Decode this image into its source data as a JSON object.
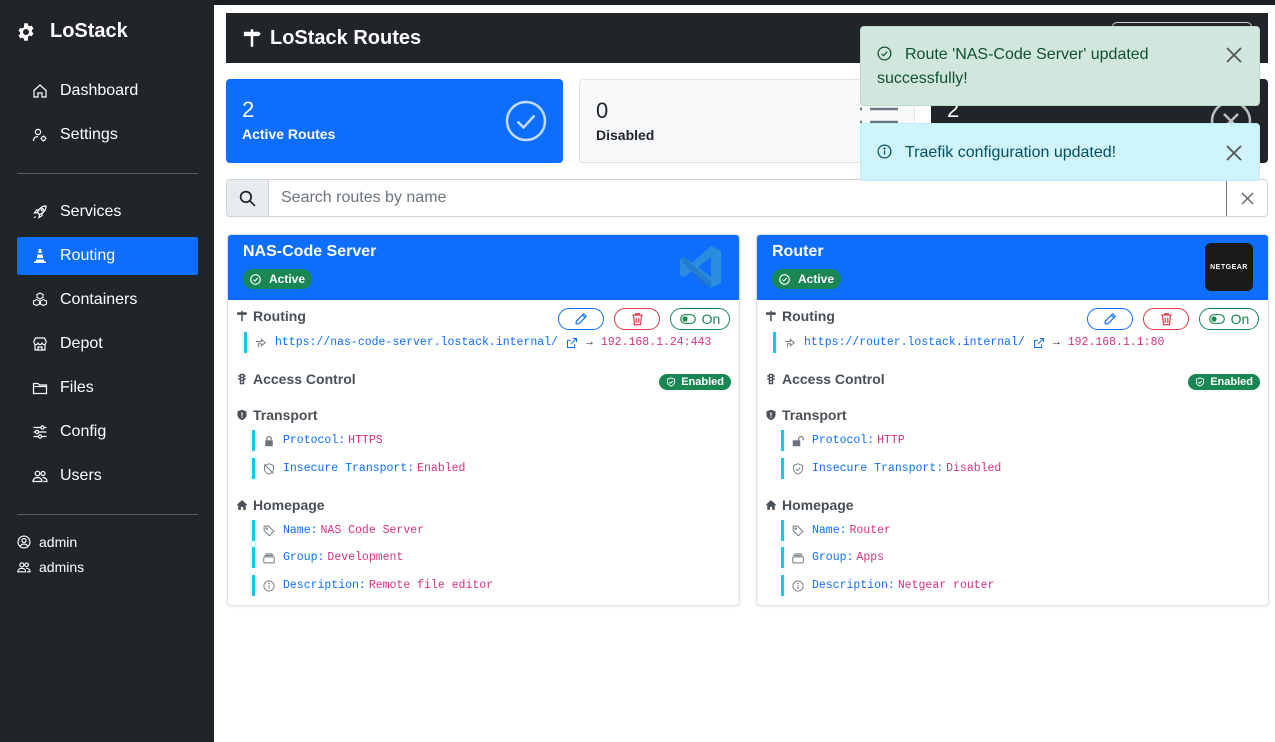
{
  "app": {
    "name": "LoStack"
  },
  "sidebar": {
    "items": [
      {
        "label": "Dashboard",
        "icon": "home-icon"
      },
      {
        "label": "Settings",
        "icon": "user-gear-icon"
      },
      {
        "label": "Services",
        "icon": "rocket-icon"
      },
      {
        "label": "Routing",
        "icon": "traffic-cone-icon",
        "active": true
      },
      {
        "label": "Containers",
        "icon": "boxes-icon"
      },
      {
        "label": "Depot",
        "icon": "store-icon"
      },
      {
        "label": "Files",
        "icon": "folder-icon"
      },
      {
        "label": "Config",
        "icon": "sliders-icon"
      },
      {
        "label": "Users",
        "icon": "users-icon"
      }
    ],
    "user": "admin",
    "group": "admins"
  },
  "header": {
    "title": "LoStack Routes"
  },
  "stats": {
    "active": {
      "count": "2",
      "label": "Active Routes"
    },
    "disabled": {
      "count": "0",
      "label": "Disabled"
    },
    "third": {
      "count": "2"
    }
  },
  "search": {
    "placeholder": "Search routes by name",
    "value": ""
  },
  "labels": {
    "routing": "Routing",
    "access_control": "Access Control",
    "transport": "Transport",
    "homepage": "Homepage",
    "enabled_badge": "Enabled",
    "active_badge": "Active",
    "on_toggle": "On",
    "protocol_key": "Protocol:",
    "insecure_key": "Insecure Transport:",
    "name_key": "Name:",
    "group_key": "Group:",
    "description_key": "Description:"
  },
  "routes": [
    {
      "title": "NAS-Code Server",
      "url": "https://nas-code-server.lostack.internal/",
      "target": "192.168.1.24:443",
      "protocol": "HTTPS",
      "insecure": "Enabled",
      "name": "NAS Code Server",
      "group": "Development",
      "description": "Remote file editor",
      "logo": "vscode-logo"
    },
    {
      "title": "Router",
      "url": "https://router.lostack.internal/",
      "target": "192.168.1.1:80",
      "protocol": "HTTP",
      "insecure": "Disabled",
      "name": "Router",
      "group": "Apps",
      "description": "Netgear router",
      "logo": "netgear-logo",
      "logo_text": "NETGEAR"
    }
  ],
  "toasts": [
    {
      "type": "success",
      "message": "Route 'NAS-Code Server' updated successfully!"
    },
    {
      "type": "info",
      "message": "Traefik configuration updated!"
    }
  ],
  "colors": {
    "primary": "#0d6efd",
    "sidebar": "#212529",
    "success": "#198754",
    "danger": "#dc3545",
    "info": "#0dcaf0"
  }
}
